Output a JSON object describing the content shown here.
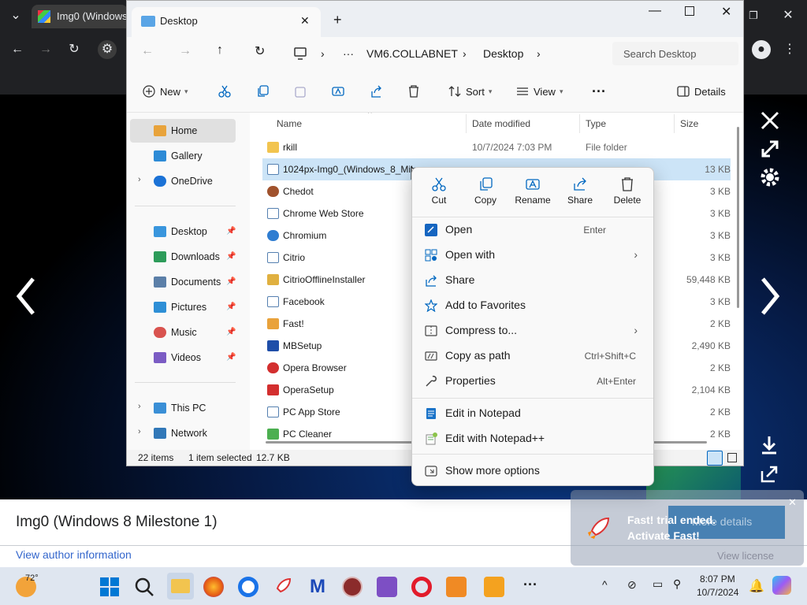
{
  "browser": {
    "tab_title": "Img0 (Windows",
    "image_caption": "Img0 (Windows 8 Milestone 1)",
    "author_link": "View author information",
    "view_license": "View license",
    "more_details": "More details"
  },
  "explorer": {
    "tab_title": "Desktop",
    "address": {
      "crumb1": "VM6.COLLABNET",
      "crumb2": "Desktop"
    },
    "search_placeholder": "Search Desktop",
    "commands": {
      "new": "New",
      "sort": "Sort",
      "view": "View",
      "details": "Details"
    },
    "nav": [
      {
        "label": "Home",
        "icon": "home-icon",
        "selected": true
      },
      {
        "label": "Gallery",
        "icon": "gallery-icon"
      },
      {
        "label": "OneDrive",
        "icon": "onedrive-icon"
      },
      {
        "label": "Desktop",
        "icon": "desktop-icon",
        "pinned": true
      },
      {
        "label": "Downloads",
        "icon": "downloads-icon",
        "pinned": true
      },
      {
        "label": "Documents",
        "icon": "documents-icon",
        "pinned": true
      },
      {
        "label": "Pictures",
        "icon": "pictures-icon",
        "pinned": true
      },
      {
        "label": "Music",
        "icon": "music-icon",
        "pinned": true
      },
      {
        "label": "Videos",
        "icon": "videos-icon",
        "pinned": true
      },
      {
        "label": "This PC",
        "icon": "this-pc-icon"
      },
      {
        "label": "Network",
        "icon": "network-icon"
      }
    ],
    "columns": {
      "name": "Name",
      "date": "Date modified",
      "type": "Type",
      "size": "Size"
    },
    "files": [
      {
        "name": "rkill",
        "date": "10/7/2024 7:03 PM",
        "type": "File folder",
        "size": ""
      },
      {
        "name": "1024px-Img0_(Windows_8_Mile",
        "date": "",
        "type": "",
        "size": "13 KB",
        "selected": true
      },
      {
        "name": "Chedot",
        "date": "",
        "type": "",
        "size": "3 KB"
      },
      {
        "name": "Chrome Web Store",
        "date": "",
        "type": "",
        "size": "3 KB"
      },
      {
        "name": "Chromium",
        "date": "",
        "type": "",
        "size": "3 KB"
      },
      {
        "name": "Citrio",
        "date": "",
        "type": "",
        "size": "3 KB"
      },
      {
        "name": "CitrioOfflineInstaller",
        "date": "",
        "type": "",
        "size": "59,448 KB"
      },
      {
        "name": "Facebook",
        "date": "",
        "type": "",
        "size": "3 KB"
      },
      {
        "name": "Fast!",
        "date": "",
        "type": "",
        "size": "2 KB"
      },
      {
        "name": "MBSetup",
        "date": "",
        "type": "",
        "size": "2,490 KB"
      },
      {
        "name": "Opera Browser",
        "date": "",
        "type": "",
        "size": "2 KB"
      },
      {
        "name": "OperaSetup",
        "date": "",
        "type": "",
        "size": "2,104 KB"
      },
      {
        "name": "PC App Store",
        "date": "",
        "type": "",
        "size": "2 KB"
      },
      {
        "name": "PC Cleaner",
        "date": "",
        "type": "",
        "size": "2 KB"
      }
    ],
    "status": {
      "items": "22 items",
      "selected": "1 item selected",
      "size": "12.7 KB"
    }
  },
  "context_menu": {
    "quick_actions": [
      "Cut",
      "Copy",
      "Rename",
      "Share",
      "Delete"
    ],
    "items": [
      {
        "label": "Open",
        "shortcut": "Enter"
      },
      {
        "label": "Open with",
        "submenu": true
      },
      {
        "label": "Share"
      },
      {
        "label": "Add to Favorites"
      },
      {
        "label": "Compress to...",
        "submenu": true
      },
      {
        "label": "Copy as path",
        "shortcut": "Ctrl+Shift+C"
      },
      {
        "label": "Properties",
        "shortcut": "Alt+Enter"
      },
      {
        "label": "Edit in Notepad"
      },
      {
        "label": "Edit with Notepad++"
      },
      {
        "label": "Show more options"
      }
    ]
  },
  "toast": {
    "line1": "Fast! trial ended.",
    "line2": "Activate Fast!"
  },
  "taskbar": {
    "weather": "72°",
    "time": "8:07 PM",
    "date": "10/7/2024"
  },
  "colors": {
    "accent": "#0067c0",
    "selection": "#cce4f7",
    "folder": "#f2c44f"
  }
}
